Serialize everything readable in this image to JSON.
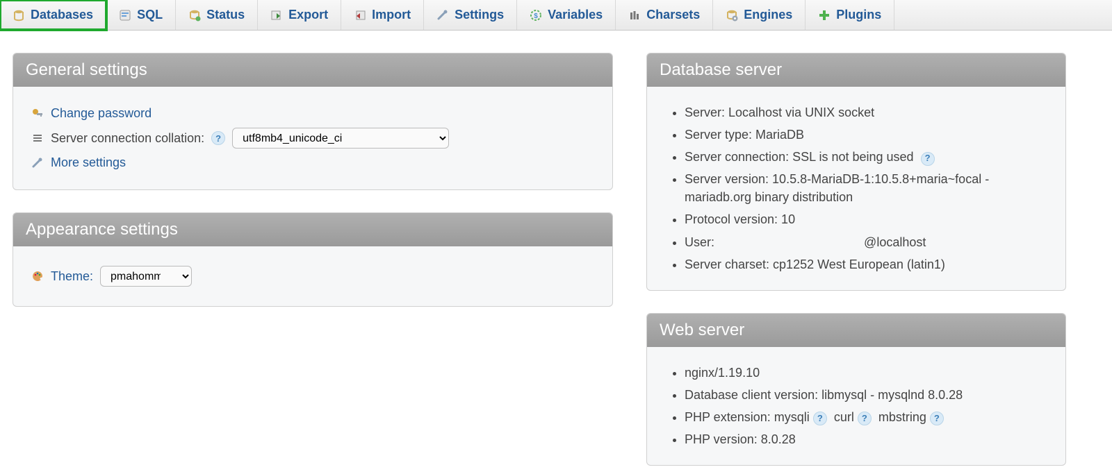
{
  "tabs": [
    {
      "key": "databases",
      "label": "Databases",
      "highlighted": true
    },
    {
      "key": "sql",
      "label": "SQL"
    },
    {
      "key": "status",
      "label": "Status"
    },
    {
      "key": "export",
      "label": "Export"
    },
    {
      "key": "import",
      "label": "Import"
    },
    {
      "key": "settings",
      "label": "Settings"
    },
    {
      "key": "variables",
      "label": "Variables"
    },
    {
      "key": "charsets",
      "label": "Charsets"
    },
    {
      "key": "engines",
      "label": "Engines"
    },
    {
      "key": "plugins",
      "label": "Plugins"
    }
  ],
  "general": {
    "title": "General settings",
    "change_password": "Change password",
    "collation_label": "Server connection collation:",
    "collation_value": "utf8mb4_unicode_ci",
    "more_settings": "More settings"
  },
  "appearance": {
    "title": "Appearance settings",
    "theme_label": "Theme:",
    "theme_value": "pmahomme"
  },
  "db_server": {
    "title": "Database server",
    "items": [
      "Server: Localhost via UNIX socket",
      "Server type: MariaDB",
      "Server connection: SSL is not being used",
      "Server version: 10.5.8-MariaDB-1:10.5.8+maria~focal - mariadb.org binary distribution",
      "Protocol version: 10",
      "User:                                           @localhost",
      "Server charset: cp1252 West European (latin1)"
    ],
    "help_after_index": 2
  },
  "web_server": {
    "title": "Web server",
    "line0": "nginx/1.19.10",
    "line1": "Database client version: libmysql - mysqlnd 8.0.28",
    "php_ext_label": "PHP extension:",
    "php_ext_1": "mysqli",
    "php_ext_2": "curl",
    "php_ext_3": "mbstring",
    "line3": "PHP version: 8.0.28"
  }
}
